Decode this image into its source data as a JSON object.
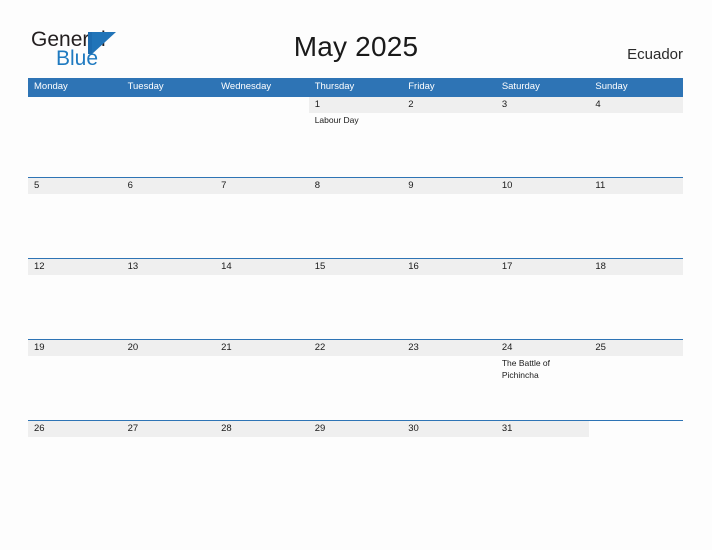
{
  "logo": {
    "word_one": "General",
    "word_two": "Blue",
    "accent_color": "#1f7ac0",
    "flag_icon": "blue-flag-triangle-icon"
  },
  "header": {
    "title": "May 2025",
    "region": "Ecuador"
  },
  "colors": {
    "header_blue": "#2e74b5",
    "date_band_gray": "#efefef",
    "page_background": "#fdfdfd",
    "text": "#1a1a1a"
  },
  "calendar": {
    "weekdays": [
      "Monday",
      "Tuesday",
      "Wednesday",
      "Thursday",
      "Friday",
      "Saturday",
      "Sunday"
    ],
    "weeks": [
      [
        {
          "day": "",
          "events": []
        },
        {
          "day": "",
          "events": []
        },
        {
          "day": "",
          "events": []
        },
        {
          "day": "1",
          "events": [
            "Labour Day"
          ]
        },
        {
          "day": "2",
          "events": []
        },
        {
          "day": "3",
          "events": []
        },
        {
          "day": "4",
          "events": []
        }
      ],
      [
        {
          "day": "5",
          "events": []
        },
        {
          "day": "6",
          "events": []
        },
        {
          "day": "7",
          "events": []
        },
        {
          "day": "8",
          "events": []
        },
        {
          "day": "9",
          "events": []
        },
        {
          "day": "10",
          "events": []
        },
        {
          "day": "11",
          "events": []
        }
      ],
      [
        {
          "day": "12",
          "events": []
        },
        {
          "day": "13",
          "events": []
        },
        {
          "day": "14",
          "events": []
        },
        {
          "day": "15",
          "events": []
        },
        {
          "day": "16",
          "events": []
        },
        {
          "day": "17",
          "events": []
        },
        {
          "day": "18",
          "events": []
        }
      ],
      [
        {
          "day": "19",
          "events": []
        },
        {
          "day": "20",
          "events": []
        },
        {
          "day": "21",
          "events": []
        },
        {
          "day": "22",
          "events": []
        },
        {
          "day": "23",
          "events": []
        },
        {
          "day": "24",
          "events": [
            "The Battle of Pichincha"
          ]
        },
        {
          "day": "25",
          "events": []
        }
      ],
      [
        {
          "day": "26",
          "events": []
        },
        {
          "day": "27",
          "events": []
        },
        {
          "day": "28",
          "events": []
        },
        {
          "day": "29",
          "events": []
        },
        {
          "day": "30",
          "events": []
        },
        {
          "day": "31",
          "events": []
        },
        {
          "day": "",
          "events": []
        }
      ]
    ]
  }
}
